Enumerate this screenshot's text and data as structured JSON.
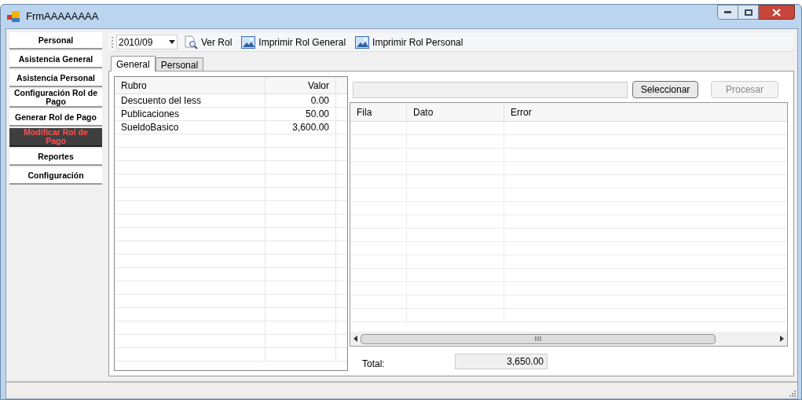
{
  "window": {
    "title": "FrmAAAAAAAA"
  },
  "sidebar": {
    "items": [
      {
        "label": "Personal",
        "selected": false
      },
      {
        "label": "Asistencia General",
        "selected": false
      },
      {
        "label": "Asistencia Personal",
        "selected": false
      },
      {
        "label": "Configuración Rol de Pago",
        "selected": false
      },
      {
        "label": "Generar Rol de Pago",
        "selected": false
      },
      {
        "label": "Modificar Rol de Pago",
        "selected": true
      },
      {
        "label": "Reportes",
        "selected": false
      },
      {
        "label": "Configuración",
        "selected": false
      }
    ]
  },
  "toolbar": {
    "period": "2010/09",
    "buttons": [
      {
        "label": "Ver Rol",
        "kind": "preview"
      },
      {
        "label": "Imprimir Rol General",
        "kind": "image"
      },
      {
        "label": "Imprimir Rol Personal",
        "kind": "image"
      }
    ]
  },
  "tabs": [
    {
      "label": "General",
      "selected": true
    },
    {
      "label": "Personal",
      "selected": false
    }
  ],
  "rubros_table": {
    "columns": [
      "Rubro",
      "Valor"
    ],
    "rows": [
      [
        "Descuento del Iess",
        "0.00"
      ],
      [
        "Publicaciones",
        "50.00"
      ],
      [
        "SueldoBasico",
        "3,600.00"
      ]
    ]
  },
  "import": {
    "buttons": [
      {
        "label": "Seleccionar",
        "disabled": false
      },
      {
        "label": "Procesar",
        "disabled": true
      }
    ]
  },
  "errors_table": {
    "columns": [
      "Fila",
      "Dato",
      "Error"
    ]
  },
  "total": {
    "label": "Total:",
    "value": "3,650.00"
  }
}
